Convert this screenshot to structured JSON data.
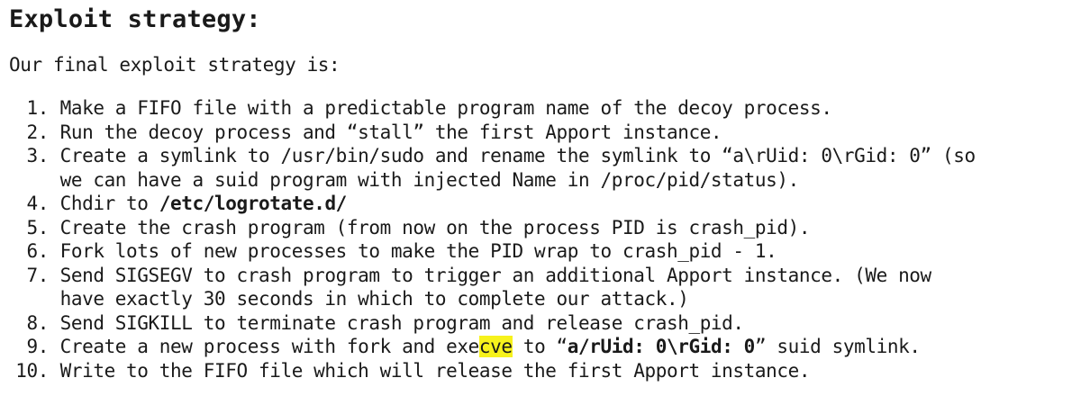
{
  "heading": "Exploit strategy:",
  "intro": "Our final exploit strategy is:",
  "steps": [
    {
      "num": "1.",
      "lines": [
        "Make a FIFO file with a predictable program name of the decoy process."
      ]
    },
    {
      "num": "2.",
      "lines": [
        "Run the decoy process and “stall” the first Apport instance."
      ]
    },
    {
      "num": "3.",
      "lines": [
        "Create a symlink to /usr/bin/sudo and rename the symlink to “a\\rUid: 0\\rGid: 0” (so",
        "we can have a suid program with injected Name in /proc/pid/status)."
      ]
    },
    {
      "num": "4.",
      "prefix": "Chdir to ",
      "bold": "/etc/logrotate.d/"
    },
    {
      "num": "5.",
      "lines": [
        "Create the crash program (from now on the process PID is crash_pid)."
      ]
    },
    {
      "num": "6.",
      "lines": [
        "Fork lots of new processes to make the PID wrap to crash_pid - 1."
      ]
    },
    {
      "num": "7.",
      "lines": [
        "Send SIGSEGV to crash program to trigger an additional Apport instance. (We now",
        "have exactly 30 seconds in which to complete our attack.)"
      ]
    },
    {
      "num": "8.",
      "lines": [
        "Send SIGKILL to terminate crash program and release crash_pid."
      ]
    },
    {
      "num": "9.",
      "prefix": "Create a new process with fork and exe",
      "highlight": "cve",
      "middle": " to “",
      "bold": "a/rUid: 0\\rGid: 0",
      "suffix": "” suid symlink."
    },
    {
      "num": "10.",
      "lines": [
        "Write to the FIFO file which will release the first Apport instance."
      ]
    }
  ]
}
